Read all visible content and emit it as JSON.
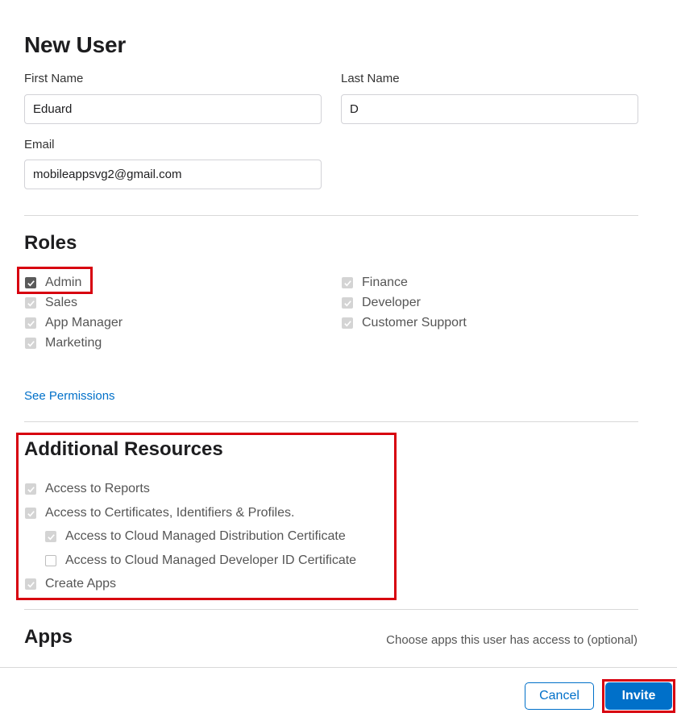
{
  "dialog": {
    "title": "New User"
  },
  "form": {
    "first_name": {
      "label": "First Name",
      "value": "Eduard"
    },
    "last_name": {
      "label": "Last Name",
      "value": "D"
    },
    "email": {
      "label": "Email",
      "value": "mobileappsvg2@gmail.com"
    }
  },
  "roles": {
    "heading": "Roles",
    "items": [
      {
        "label": "Admin",
        "checked": true,
        "disabled": false
      },
      {
        "label": "Sales",
        "checked": true,
        "disabled": true
      },
      {
        "label": "App Manager",
        "checked": true,
        "disabled": true
      },
      {
        "label": "Marketing",
        "checked": true,
        "disabled": true
      },
      {
        "label": "Finance",
        "checked": true,
        "disabled": true
      },
      {
        "label": "Developer",
        "checked": true,
        "disabled": true
      },
      {
        "label": "Customer Support",
        "checked": true,
        "disabled": true
      }
    ],
    "see_permissions": "See Permissions"
  },
  "resources": {
    "heading": "Additional Resources",
    "items": [
      {
        "label": "Access to Reports",
        "checked": true,
        "disabled": true
      },
      {
        "label": "Access to Certificates, Identifiers & Profiles.",
        "checked": true,
        "disabled": true
      },
      {
        "label": "Access to Cloud Managed Distribution Certificate",
        "checked": true,
        "disabled": true
      },
      {
        "label": "Access to Cloud Managed Developer ID Certificate",
        "checked": false,
        "disabled": false
      },
      {
        "label": "Create Apps",
        "checked": true,
        "disabled": true
      }
    ]
  },
  "apps": {
    "heading": "Apps",
    "hint": "Choose apps this user has access to (optional)"
  },
  "footer": {
    "cancel_label": "Cancel",
    "invite_label": "Invite"
  },
  "colors": {
    "accent": "#0070c9",
    "highlight": "#d7000f",
    "disabled_check": "#d4d4d4"
  }
}
